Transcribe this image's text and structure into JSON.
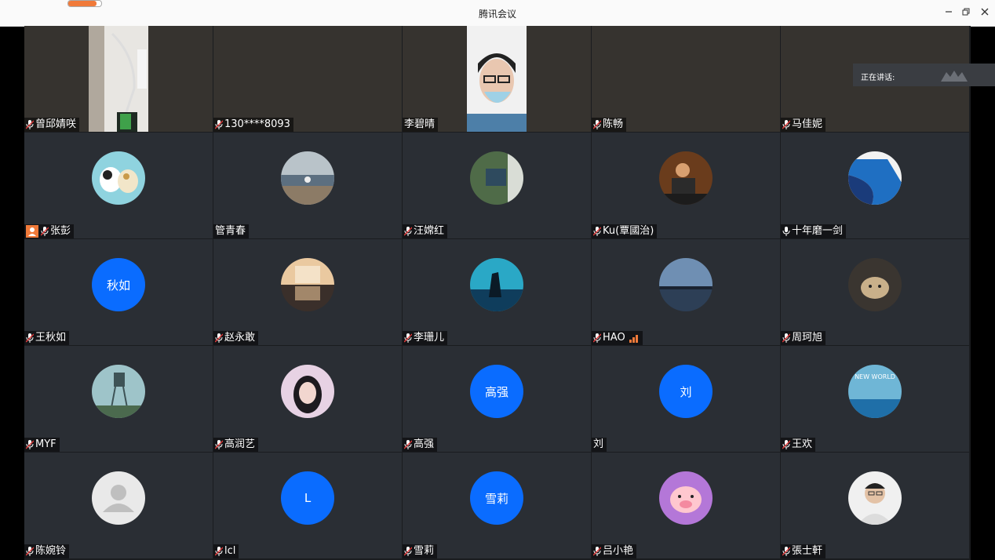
{
  "window": {
    "title": "腾讯会议",
    "progress": 0.85
  },
  "speaking": {
    "label": "正在讲话:"
  },
  "rows": [
    [
      {
        "name": "曾邱婧咲",
        "style": "video-cable",
        "mic": "muted"
      },
      {
        "name": "130****8093",
        "style": "dark",
        "mic": "muted"
      },
      {
        "name": "李碧晴",
        "style": "video-face",
        "mic": "none"
      },
      {
        "name": "陈畅",
        "style": "dark",
        "mic": "muted"
      },
      {
        "name": "马佳妮",
        "style": "dark",
        "mic": "muted"
      }
    ],
    [
      {
        "name": "张彭",
        "style": "avatar",
        "img": "cartoon-dogs",
        "mic": "muted",
        "host": true
      },
      {
        "name": "管青春",
        "style": "avatar",
        "img": "lake-person",
        "mic": "none"
      },
      {
        "name": "汪嫦红",
        "style": "avatar",
        "img": "green-sign",
        "mic": "muted"
      },
      {
        "name": "Ku(覃國治)",
        "style": "avatar",
        "img": "man-stage",
        "mic": "muted"
      },
      {
        "name": "十年磨一剑",
        "style": "avatar",
        "img": "blue-coast",
        "mic": "on"
      }
    ],
    [
      {
        "name": "王秋如",
        "style": "text",
        "text": "秋如",
        "mic": "muted"
      },
      {
        "name": "赵永敢",
        "style": "avatar",
        "img": "building-reflection",
        "mic": "muted"
      },
      {
        "name": "李珊儿",
        "style": "avatar",
        "img": "aquarium",
        "mic": "muted"
      },
      {
        "name": "HAO",
        "style": "avatar",
        "img": "evening-lake",
        "mic": "muted",
        "signal": true
      },
      {
        "name": "周珂旭",
        "style": "avatar",
        "img": "cat",
        "mic": "muted"
      }
    ],
    [
      {
        "name": "MYF",
        "style": "avatar",
        "img": "water-tower",
        "mic": "muted"
      },
      {
        "name": "高润艺",
        "style": "avatar",
        "img": "girl-portrait",
        "mic": "muted"
      },
      {
        "name": "高强",
        "style": "text",
        "text": "高强",
        "mic": "muted"
      },
      {
        "name": "刘",
        "style": "text",
        "text": "刘",
        "mic": "none"
      },
      {
        "name": "王欢",
        "style": "avatar",
        "img": "new-world",
        "mic": "muted"
      }
    ],
    [
      {
        "name": "陈婉铃",
        "style": "avatar",
        "img": "default-user",
        "mic": "muted"
      },
      {
        "name": "lcl",
        "style": "text",
        "text": "L",
        "mic": "muted"
      },
      {
        "name": "雪莉",
        "style": "text",
        "text": "雪莉",
        "mic": "muted"
      },
      {
        "name": "吕小艳",
        "style": "avatar",
        "img": "pink-pig",
        "mic": "muted"
      },
      {
        "name": "張士軒",
        "style": "avatar",
        "img": "man-glasses",
        "mic": "muted"
      }
    ]
  ],
  "colors": {
    "accent": "#0a6cff",
    "host_badge": "#f07a3a",
    "muted_red": "#e23b3b",
    "tile_bg": "#2a2e34"
  }
}
